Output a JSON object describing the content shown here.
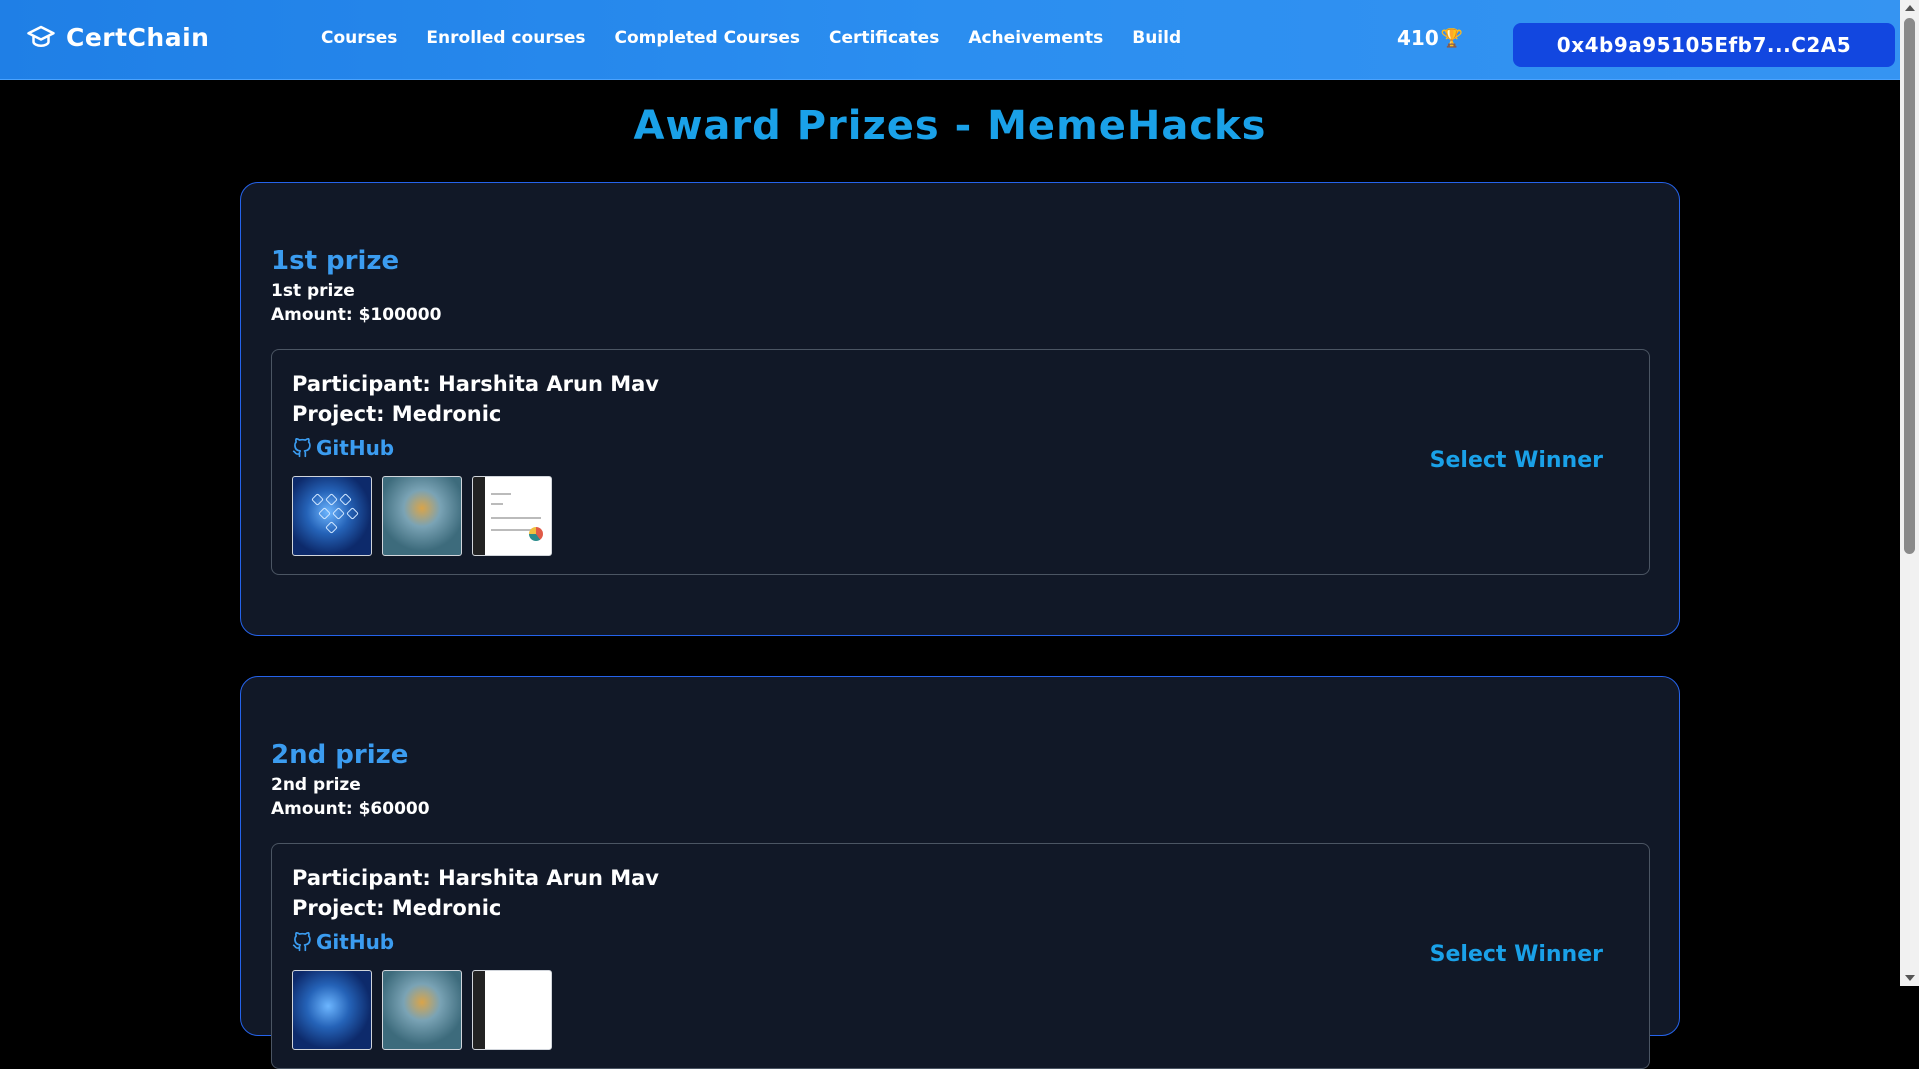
{
  "navbar": {
    "brand": "CertChain",
    "links": [
      "Courses",
      "Enrolled courses",
      "Completed Courses",
      "Certificates",
      "Acheivements",
      "Build"
    ],
    "points": "410",
    "trophy_icon": "🏆",
    "wallet": "0x4b9a95105Efb7...C2A5"
  },
  "page": {
    "title": "Award Prizes - MemeHacks"
  },
  "prizes": [
    {
      "name": "1st prize",
      "description": "1st prize",
      "amount": "Amount: $100000",
      "submission": {
        "participant": "Participant: Harshita Arun Mav",
        "project": "Project: Medronic",
        "github_label": "GitHub",
        "action_label": "Select Winner"
      }
    },
    {
      "name": "2nd prize",
      "description": "2nd prize",
      "amount": "Amount: $60000",
      "submission": {
        "participant": "Participant: Harshita Arun Mav",
        "project": "Project: Medronic",
        "github_label": "GitHub",
        "action_label": "Select Winner"
      }
    }
  ],
  "colors": {
    "accent": "#1aa1e8",
    "link": "#3b9cf0",
    "card_bg": "#111827",
    "card_border": "#2563eb",
    "wallet_bg": "#1247e0"
  }
}
